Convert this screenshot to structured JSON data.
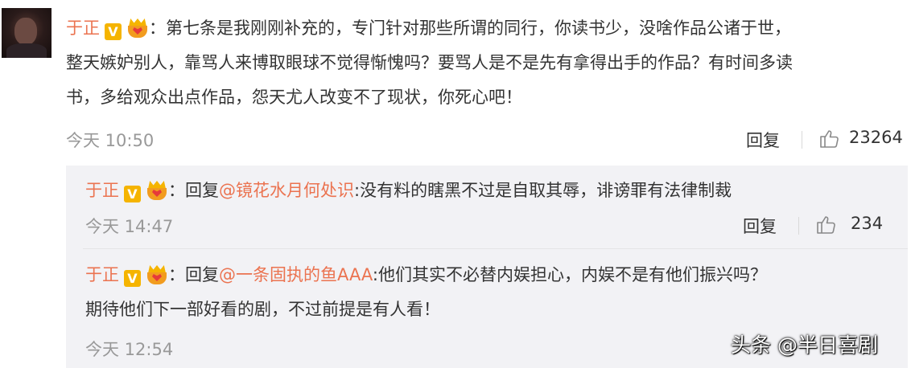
{
  "main_comment": {
    "username": "于正",
    "v_badge": "V",
    "line1": "：第七条是我刚刚补充的，专门针对那些所谓的同行，你读书少，没啥作品公诸于世，",
    "line2": "整天嫉妒别人，靠骂人来博取眼球不觉得惭愧吗？要骂人是不是先有拿得出手的作品？有时间多读",
    "line3": "书，多给观众出点作品，怨天尤人改变不了现状，你死心吧！",
    "time": "今天 10:50",
    "reply_label": "回复",
    "like_count": "23264"
  },
  "replies": [
    {
      "username": "于正",
      "v_badge": "V",
      "prefix": "：回复",
      "mention": "@镜花水月何处识",
      "text": ":没有料的瞎黑不过是自取其辱，诽谤罪有法律制裁",
      "time": "今天 14:47",
      "reply_label": "回复",
      "like_count": "234"
    },
    {
      "username": "于正",
      "v_badge": "V",
      "prefix": "：回复",
      "mention": "@一条固执的鱼AAA",
      "text": ":他们其实不必替内娱担心，内娱不是有他们振兴吗？",
      "text_line2": "期待他们下一部好看的剧，不过前提是有人看！",
      "time": "今天 12:54"
    }
  ],
  "watermark": "头条 @半日喜剧",
  "colors": {
    "username": "#eb7350",
    "badge": "#f5b400",
    "meta": "#999999",
    "reply_bg": "#f2f2f5"
  },
  "icons": [
    "avatar",
    "v-badge-icon",
    "crown-heart-icon",
    "thumbs-up-icon"
  ]
}
